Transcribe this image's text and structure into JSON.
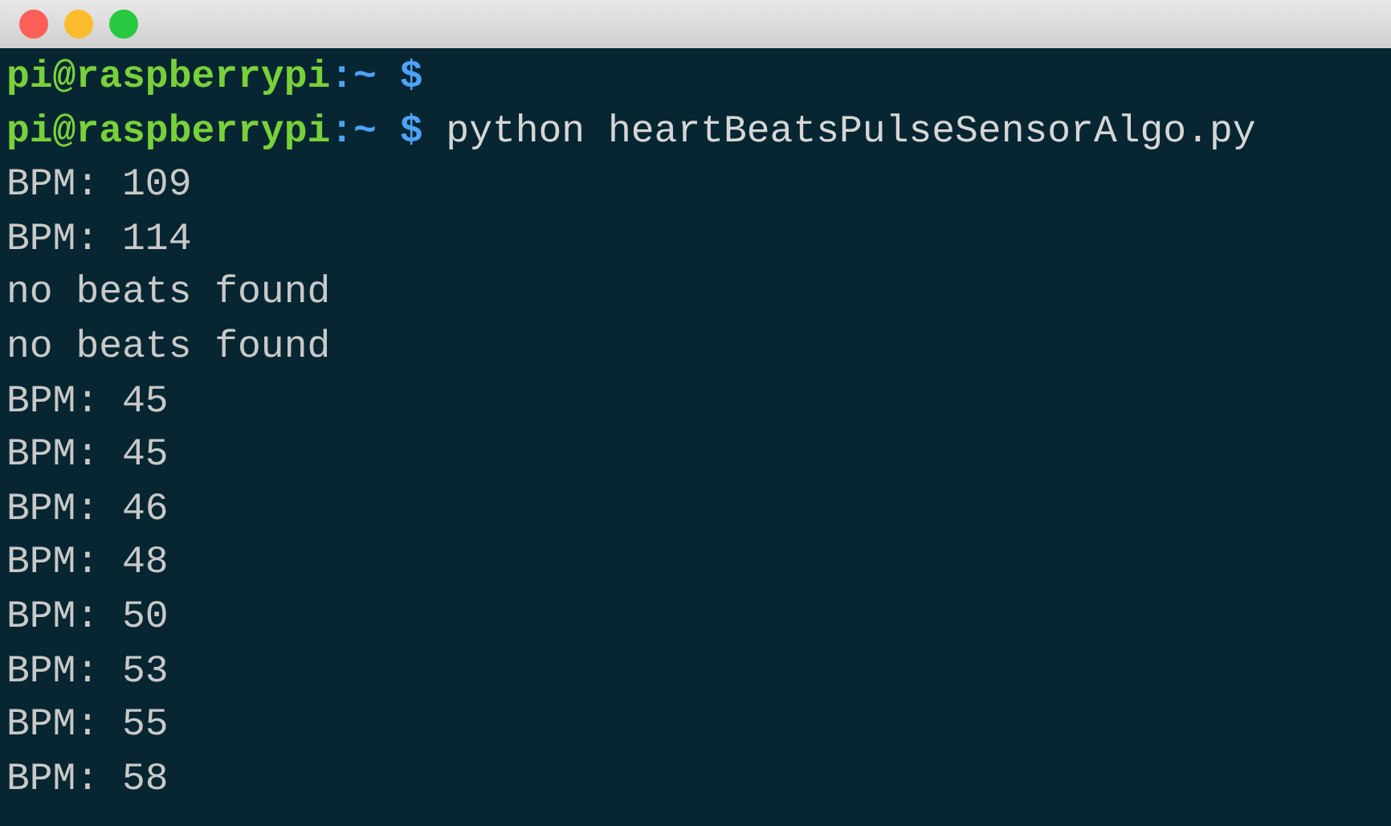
{
  "terminal": {
    "lines": [
      {
        "kind": "prompt",
        "user_host": "pi@raspberrypi",
        "path": ":~",
        "symbol": "$"
      },
      {
        "kind": "prompt",
        "user_host": "pi@raspberrypi",
        "path": ":~",
        "symbol": "$",
        "command": "python heartBeatsPulseSensorAlgo.py"
      },
      {
        "kind": "output",
        "text": "BPM: 109"
      },
      {
        "kind": "output",
        "text": "BPM: 114"
      },
      {
        "kind": "output",
        "text": "no beats found"
      },
      {
        "kind": "output",
        "text": "no beats found"
      },
      {
        "kind": "output",
        "text": "BPM: 45"
      },
      {
        "kind": "output",
        "text": "BPM: 45"
      },
      {
        "kind": "output",
        "text": "BPM: 46"
      },
      {
        "kind": "output",
        "text": "BPM: 48"
      },
      {
        "kind": "output",
        "text": "BPM: 50"
      },
      {
        "kind": "output",
        "text": "BPM: 53"
      },
      {
        "kind": "output",
        "text": "BPM: 55"
      },
      {
        "kind": "output",
        "text": "BPM: 58"
      }
    ]
  }
}
